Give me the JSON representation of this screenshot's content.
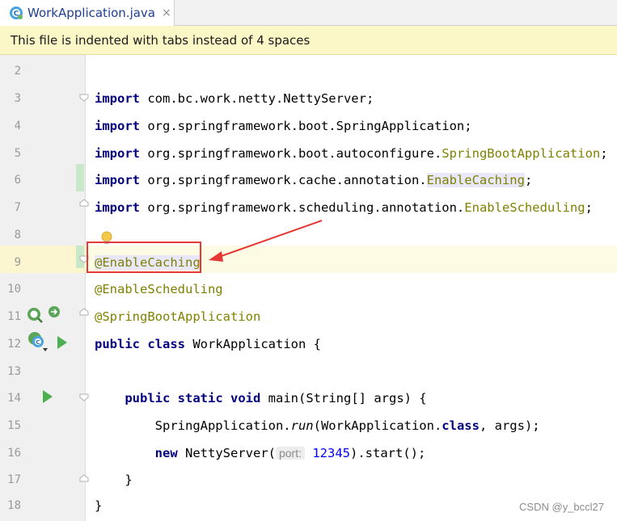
{
  "tab": {
    "title": "WorkApplication.java",
    "close": "×",
    "icon": "java-class-icon"
  },
  "banner": {
    "text": "This file is indented with tabs instead of 4 spaces"
  },
  "lines": [
    {
      "n": "2"
    },
    {
      "n": "3",
      "t1": "import",
      "t2": " com.bc.work.netty.NettyServer;"
    },
    {
      "n": "4",
      "t1": "import",
      "t2": " org.springframework.boot.SpringApplication;"
    },
    {
      "n": "5",
      "t1": "import",
      "t2": " org.springframework.boot.autoconfigure.",
      "t3": "SpringBootApplication",
      "t4": ";"
    },
    {
      "n": "6",
      "t1": "import",
      "t2": " org.springframework.cache.annotation.",
      "t3": "EnableCaching",
      "t4": ";"
    },
    {
      "n": "7",
      "t1": "import",
      "t2": " org.springframework.scheduling.annotation.",
      "t3": "EnableScheduling",
      "t4": ";"
    },
    {
      "n": "8"
    },
    {
      "n": "9",
      "t1": "@EnableCaching"
    },
    {
      "n": "10",
      "t1": "@EnableScheduling"
    },
    {
      "n": "11",
      "t1": "@SpringBootApplication"
    },
    {
      "n": "12",
      "t1": "public",
      "t2": " ",
      "t3": "class",
      "t4": " WorkApplication {"
    },
    {
      "n": "13"
    },
    {
      "n": "14",
      "t0": "    ",
      "t1": "public",
      "t2": " ",
      "t3": "static",
      "t4": " ",
      "t5": "void",
      "t6": " main(String[] args) {"
    },
    {
      "n": "15",
      "t0": "        SpringApplication.",
      "t1": "run",
      "t2": "(WorkApplication.",
      "t3": "class",
      "t4": ", args);"
    },
    {
      "n": "16",
      "t0": "        ",
      "t1": "new",
      "t2": " NettyServer(",
      "t3": "port:",
      "t4": " ",
      "t5": "12345",
      "t6": ").start();"
    },
    {
      "n": "17",
      "t0": "    }"
    },
    {
      "n": "18",
      "t0": "}"
    }
  ],
  "watermark": "CSDN @y_bccl27",
  "colors": {
    "keyword": "#000080",
    "annotation": "#808000",
    "number": "#0000ff",
    "highlight_box": "#e53935",
    "banner_bg": "#fcf7c6"
  },
  "icons": {
    "gutter_11_a": "bean-search-icon",
    "gutter_11_b": "spring-navigate-icon",
    "gutter_12": "spring-class-icon",
    "run_12": "run-icon",
    "run_14": "run-icon",
    "line_8": "intention-bulb-icon"
  }
}
